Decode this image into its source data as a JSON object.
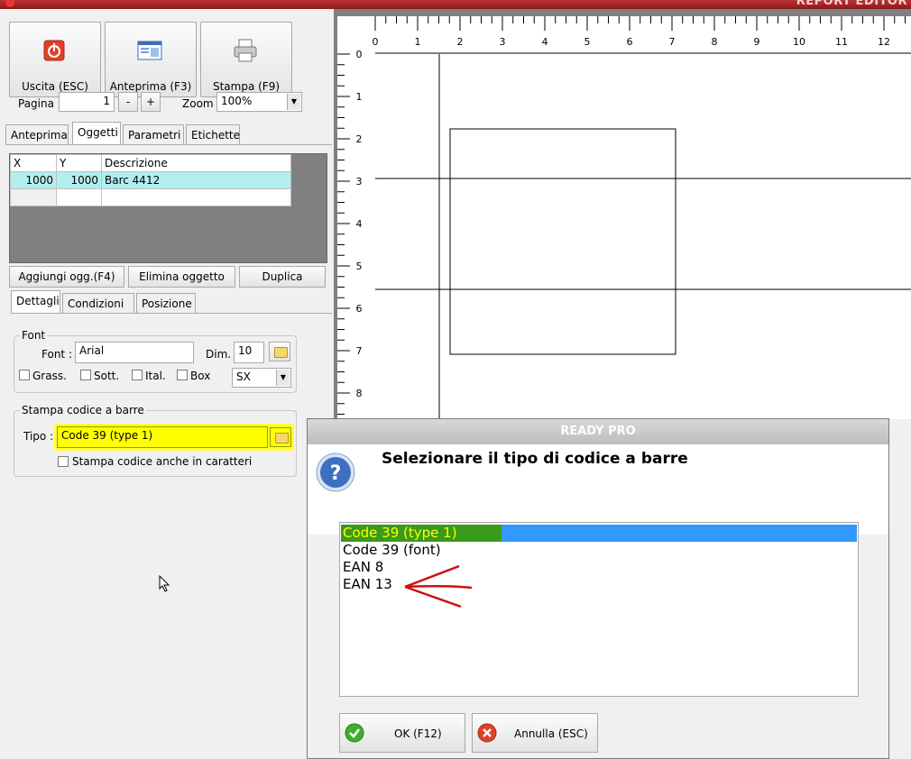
{
  "window": {
    "title": "REPORT EDITOR"
  },
  "toolbar": {
    "exit_label": "Uscita (ESC)",
    "preview_label": "Anteprima (F3)",
    "print_label": "Stampa (F9)"
  },
  "page_controls": {
    "page_label": "Pagina",
    "page_value": "1",
    "minus_label": "-",
    "plus_label": "+",
    "zoom_label": "Zoom",
    "zoom_value": "100%"
  },
  "main_tabs": [
    {
      "label": "Anteprima"
    },
    {
      "label": "Oggetti"
    },
    {
      "label": "Parametri"
    },
    {
      "label": "Etichette"
    }
  ],
  "objects_table": {
    "headers": [
      "X",
      "Y",
      "Descrizione"
    ],
    "rows": [
      {
        "x": "1000",
        "y": "1000",
        "desc": "Barc 4412"
      }
    ]
  },
  "object_buttons": {
    "add_label": "Aggiungi ogg.(F4)",
    "delete_label": "Elimina oggetto",
    "duplicate_label": "Duplica"
  },
  "detail_tabs": [
    {
      "label": "Dettagli"
    },
    {
      "label": "Condizioni"
    },
    {
      "label": "Posizione"
    }
  ],
  "font_group": {
    "title": "Font",
    "font_label": "Font :",
    "font_value": "Arial",
    "size_label": "Dim.",
    "size_value": "10",
    "bold_label": "Grass.",
    "underline_label": "Sott.",
    "italic_label": "Ital.",
    "box_label": "Box",
    "align_value": "SX"
  },
  "barcode_group": {
    "title": "Stampa codice a barre",
    "type_label": "Tipo :",
    "type_value": "Code 39 (type 1)",
    "print_chars_label": "Stampa codice anche in caratteri"
  },
  "ruler": {
    "top_ticks": [
      "0",
      "1",
      "2",
      "3",
      "4",
      "5",
      "6",
      "7",
      "8",
      "9",
      "10",
      "11",
      "12"
    ],
    "left_ticks": [
      "0",
      "1",
      "2",
      "3",
      "4",
      "5",
      "6",
      "7",
      "8"
    ]
  },
  "dialog": {
    "title": "READY PRO",
    "message": "Selezionare il tipo di codice a barre",
    "options": [
      {
        "label": "Code 39 (type 1)"
      },
      {
        "label": "Code 39 (font)"
      },
      {
        "label": "EAN 8"
      },
      {
        "label": "EAN 13"
      }
    ],
    "ok_label": "OK (F12)",
    "cancel_label": "Annulla (ESC)"
  },
  "colors": {
    "selection_highlight": "#ffff00",
    "selection_green": "#3a9a1a",
    "list_selection_blue": "#3399ff",
    "row_selected": "#b2eeee",
    "annotation_arrow": "#cc1111"
  }
}
